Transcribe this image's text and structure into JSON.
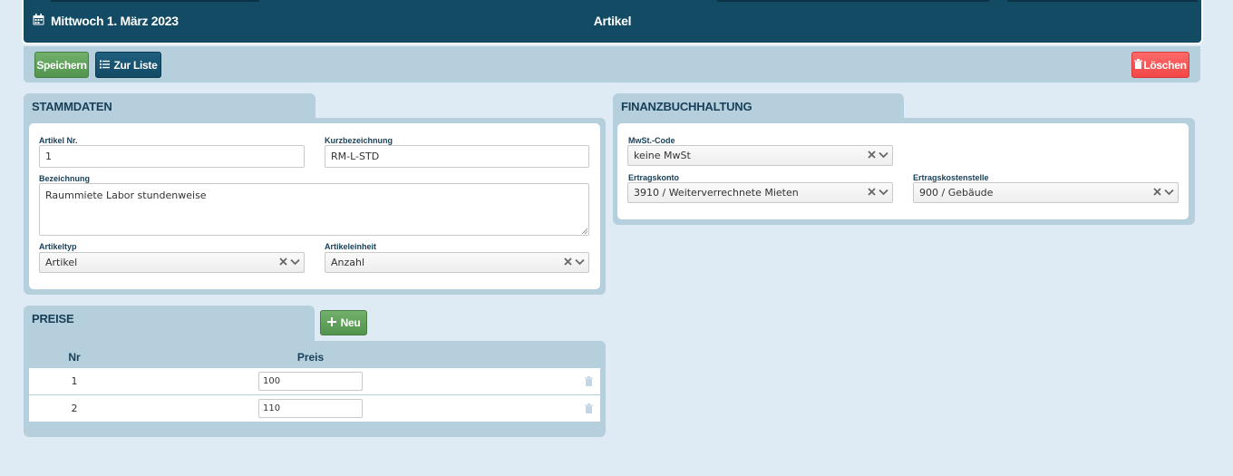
{
  "header": {
    "date": "Mittwoch 1. März 2023",
    "title": "Artikel"
  },
  "toolbar": {
    "save": "Speichern",
    "to_list": "Zur Liste",
    "delete": "Löschen"
  },
  "stammdaten": {
    "title": "STAMMDATEN",
    "artikel_nr": {
      "label": "Artikel Nr.",
      "value": "1"
    },
    "kurzbezeichnung": {
      "label": "Kurzbezeichnung",
      "value": "RM-L-STD"
    },
    "bezeichnung": {
      "label": "Bezeichnung",
      "value": "Raummiete Labor stundenweise"
    },
    "artikeltyp": {
      "label": "Artikeltyp",
      "value": "Artikel"
    },
    "artikeleinheit": {
      "label": "Artikeleinheit",
      "value": "Anzahl"
    }
  },
  "fibu": {
    "title": "FINANZBUCHHALTUNG",
    "mwst": {
      "label": "MwSt.-Code",
      "value": "keine MwSt"
    },
    "ertragskonto": {
      "label": "Ertragskonto",
      "value": "3910 / Weiterverrechnete Mieten"
    },
    "kostenstelle": {
      "label": "Ertragskostenstelle",
      "value": "900 / Gebäude"
    }
  },
  "preise": {
    "title": "PREISE",
    "new_button": "Neu",
    "columns": {
      "nr": "Nr",
      "preis": "Preis"
    },
    "rows": [
      {
        "nr": "1",
        "preis": "100"
      },
      {
        "nr": "2",
        "preis": "110"
      }
    ]
  },
  "colors": {
    "header": "#134a64",
    "panel": "#b6cfdd",
    "green": "#5fa35a",
    "red": "#f24747"
  },
  "icons": [
    "calendar-icon",
    "list-icon",
    "trash-icon",
    "plus-icon",
    "clear-icon",
    "chevron-down-icon"
  ]
}
